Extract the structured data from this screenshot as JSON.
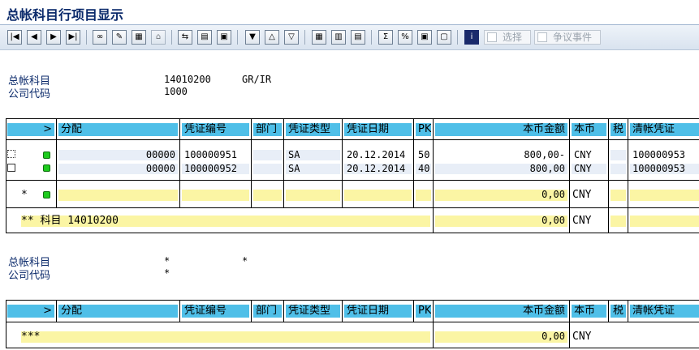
{
  "window": {
    "title": "总帐科目行项目显示"
  },
  "toolbar": {
    "select_label": "选择",
    "dispute_label": "争议事件"
  },
  "group1": {
    "account_label": "总帐科目",
    "account_value": "14010200",
    "account_desc": "GR/IR",
    "company_label": "公司代码",
    "company_value": "1000"
  },
  "group2": {
    "account_label": "总帐科目",
    "account_value": "*",
    "account_desc": "*",
    "company_label": "公司代码",
    "company_value": "*"
  },
  "table": {
    "arrow": ">",
    "columns": [
      "分配",
      "凭证编号",
      "部门",
      "凭证类型",
      "凭证日期",
      "PK",
      "本币金额",
      "本币",
      "税",
      "清帐凭证"
    ],
    "rows": [
      {
        "assignment": "00000",
        "doc_no": "100000951",
        "doc_type": "SA",
        "doc_date": "20.12.2014",
        "pk": "50",
        "amount": "800,00-",
        "currency": "CNY",
        "clearing": "100000953"
      },
      {
        "assignment": "00000",
        "doc_no": "100000952",
        "doc_type": "SA",
        "doc_date": "20.12.2014",
        "pk": "40",
        "amount": "800,00",
        "currency": "CNY",
        "clearing": "100000953"
      }
    ],
    "subtotal": {
      "marker": "*",
      "amount": "0,00",
      "currency": "CNY"
    },
    "total": {
      "marker": "** 科目 14010200",
      "amount": "0,00",
      "currency": "CNY"
    }
  },
  "table2": {
    "grand": {
      "marker": "***",
      "amount": "0,00",
      "currency": "CNY"
    }
  },
  "icons": [
    "first-page-icon",
    "prev-page-icon",
    "next-page-icon",
    "last-page-icon",
    "glasses-icon",
    "pencil-icon",
    "grid-icon",
    "detail-icon",
    "export-icon",
    "print-icon",
    "filter-icon",
    "sort-asc-icon",
    "sort-desc-icon",
    "layout-icon",
    "columns-icon",
    "summary-icon",
    "subtotal-icon",
    "graphic-icon",
    "info-icon"
  ],
  "colors": {
    "header": "#4fbfe8",
    "yellow": "#fbf5a4",
    "title": "#0b2a6b",
    "led": "#1ecb1e"
  }
}
